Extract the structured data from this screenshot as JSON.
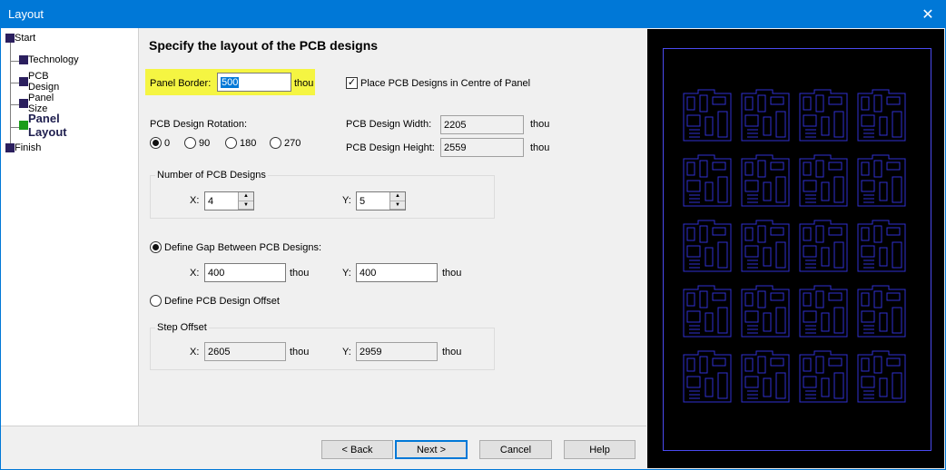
{
  "window": {
    "title": "Layout",
    "close_glyph": "✕"
  },
  "tree": {
    "items": [
      {
        "label": "Start",
        "color": "#2b1f5e"
      },
      {
        "label": "Technology",
        "color": "#2b1f5e"
      },
      {
        "label": "PCB Design",
        "color": "#2b1f5e"
      },
      {
        "label": "Panel Size",
        "color": "#2b1f5e"
      },
      {
        "label": "Panel Layout",
        "color": "#1a9c1a",
        "active": true
      },
      {
        "label": "Finish",
        "color": "#2b1f5e"
      }
    ]
  },
  "main": {
    "heading": "Specify the layout of the PCB designs",
    "panel_border": {
      "label": "Panel Border:",
      "value": "500",
      "unit": "thou"
    },
    "centre": {
      "label": "Place PCB Designs in Centre of Panel",
      "checked": true
    },
    "rotation": {
      "label": "PCB Design Rotation:",
      "options": [
        "0",
        "90",
        "180",
        "270"
      ],
      "selected": "0"
    },
    "width": {
      "label": "PCB Design Width:",
      "value": "2205",
      "unit": "thou"
    },
    "height": {
      "label": "PCB Design Height:",
      "value": "2559",
      "unit": "thou"
    },
    "number_group": {
      "title": "Number of PCB Designs",
      "x_label": "X:",
      "x_value": "4",
      "y_label": "Y:",
      "y_value": "5"
    },
    "gap": {
      "label": "Define Gap Between PCB Designs:",
      "selected": true,
      "x_label": "X:",
      "x_value": "400",
      "x_unit": "thou",
      "y_label": "Y:",
      "y_value": "400",
      "y_unit": "thou"
    },
    "offset": {
      "label": "Define PCB Design Offset",
      "selected": false
    },
    "step_group": {
      "title": "Step Offset",
      "x_label": "X:",
      "x_value": "2605",
      "x_unit": "thou",
      "y_label": "Y:",
      "y_value": "2959",
      "y_unit": "thou"
    }
  },
  "buttons": {
    "back": "< Back",
    "next": "Next >",
    "cancel": "Cancel",
    "help": "Help"
  },
  "preview": {
    "columns": 4,
    "rows": 5,
    "outline_color": "#4a4af0",
    "board_color": "#3030d0"
  }
}
